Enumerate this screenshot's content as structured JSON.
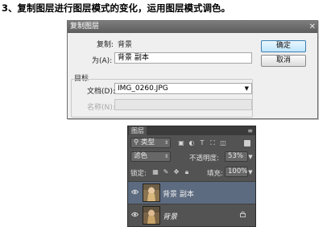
{
  "caption": "3、复制图层进行图层模式的变化，运用图层模式调色。",
  "dialog": {
    "title": "复制图层",
    "close_glyph": "✕",
    "duplicate_label": "复制:",
    "duplicate_value": "背景",
    "as_label": "为(A):",
    "as_value": "背景 副本",
    "ok_label": "确定",
    "cancel_label": "取消",
    "target_group_label": "目标",
    "document_label": "文档(D):",
    "document_value": "IMG_0260.JPG",
    "name_label": "名称(N):",
    "name_value": ""
  },
  "layers_panel": {
    "tab_label": "图层",
    "menu_glyph": "≡",
    "filter_kind": "类型",
    "blend_mode": "滤色",
    "opacity_label": "不透明度:",
    "opacity_value": "53%",
    "lock_label": "锁定:",
    "fill_label": "填充:",
    "fill_value": "100%",
    "layers": [
      {
        "name": "背景 副本",
        "selected": true
      },
      {
        "name": "背景",
        "selected": false,
        "locked": true
      }
    ],
    "colors": {
      "panel_bg": "#535353",
      "selected_row": "#5c6b80",
      "header": "#3b3b3b"
    }
  },
  "colors": {
    "ok_button_border": "#3c7fb1",
    "title_bar": "#6a6a6a"
  }
}
